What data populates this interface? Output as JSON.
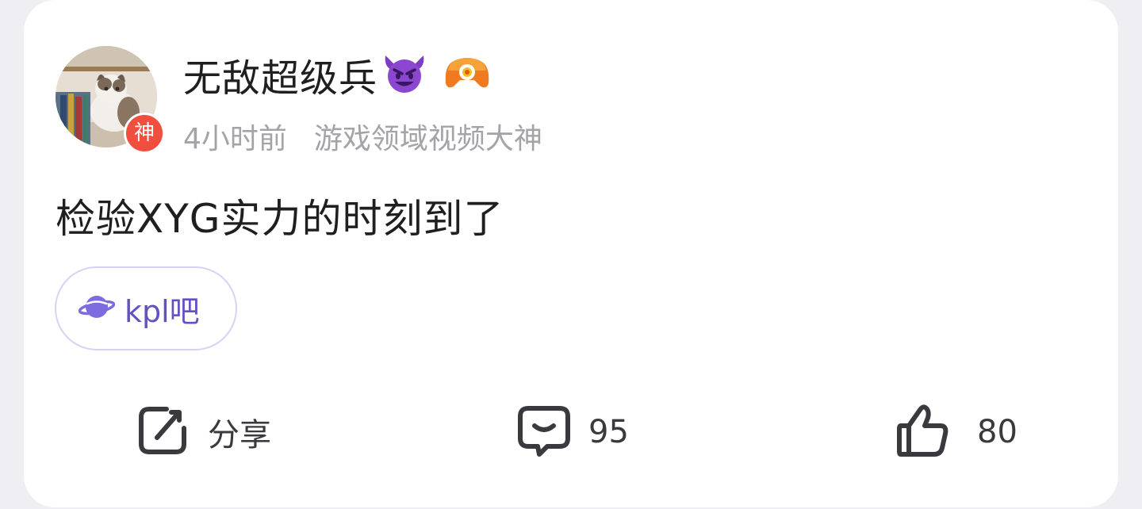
{
  "user": {
    "name": "无敌超级兵",
    "avatar": "cat-photo-avatar",
    "badge_text": "神",
    "name_emoji_icon": "smiling-devil-emoji-icon",
    "extra_badge_icon": "game-controller-badge-icon"
  },
  "meta": {
    "time": "4小时前",
    "title": "游戏领域视频大神"
  },
  "post": {
    "text": "检验XYG实力的时刻到了"
  },
  "forum": {
    "name": "kpl吧",
    "icon": "planet-icon"
  },
  "actions": {
    "share_label": "分享",
    "comment_count": "95",
    "like_count": "80"
  },
  "colors": {
    "card_bg": "#ffffff",
    "page_bg": "#efeff3",
    "badge_red": "#f04e3e",
    "forum_purple": "#6250c4",
    "forum_border": "#d8d2f4",
    "meta_gray": "#a3a3a8",
    "devil_purple": "#7b3fc0",
    "controller_orange": "#f07a1f"
  }
}
